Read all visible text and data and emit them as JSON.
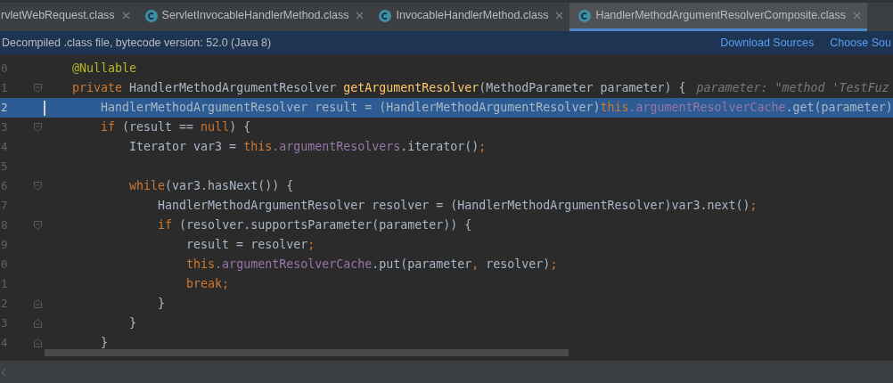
{
  "tabs": [
    {
      "label": "rvletWebRequest.class",
      "icon": false,
      "selected": false
    },
    {
      "label": "ServletInvocableHandlerMethod.class",
      "icon": true,
      "selected": false
    },
    {
      "label": "InvocableHandlerMethod.class",
      "icon": true,
      "selected": false
    },
    {
      "label": "HandlerMethodArgumentResolverComposite.class",
      "icon": true,
      "selected": true
    }
  ],
  "info_bar": {
    "message": "Decompiled .class file, bytecode version: 52.0 (Java 8)",
    "links": [
      "Download Sources",
      "Choose Sou"
    ]
  },
  "lines": [
    {
      "number": "0",
      "kind": "plain",
      "current": false,
      "tokens": [
        {
          "kind": "annotation",
          "t": "@Nullable"
        }
      ]
    },
    {
      "number": "1",
      "kind": "fold_start",
      "current": false,
      "tokens": [
        {
          "kind": "kw",
          "t": "private "
        },
        {
          "kind": "plain",
          "t": "HandlerMethodArgumentResolver "
        },
        {
          "kind": "method",
          "t": "getArgumentResolver"
        },
        {
          "kind": "plain",
          "t": "(MethodParameter parameter) {"
        }
      ],
      "hint": "parameter: \"method 'TestFuz"
    },
    {
      "number": "2",
      "kind": "plain",
      "current": true,
      "tokens": [
        {
          "kind": "plain",
          "t": "    HandlerMethodArgumentResolver result = (HandlerMethodArgumentResolver)"
        },
        {
          "kind": "kw",
          "t": "this"
        },
        {
          "kind": "field",
          "t": ".argumentResolverCache"
        },
        {
          "kind": "plain",
          "t": ".get(parameter)"
        }
      ]
    },
    {
      "number": "3",
      "kind": "fold_start",
      "current": false,
      "tokens": [
        {
          "kind": "kw",
          "t": "    if "
        },
        {
          "kind": "plain",
          "t": "(result == "
        },
        {
          "kind": "kw",
          "t": "null"
        },
        {
          "kind": "plain",
          "t": ") {"
        }
      ]
    },
    {
      "number": "4",
      "kind": "plain",
      "current": false,
      "tokens": [
        {
          "kind": "plain",
          "t": "        Iterator var3 = "
        },
        {
          "kind": "kw",
          "t": "this"
        },
        {
          "kind": "field",
          "t": ".argumentResolvers"
        },
        {
          "kind": "plain",
          "t": ".iterator()"
        },
        {
          "kind": "kw",
          "t": ";"
        }
      ]
    },
    {
      "number": "5",
      "kind": "plain",
      "current": false
    },
    {
      "number": "6",
      "kind": "fold_start",
      "current": false,
      "tokens": [
        {
          "kind": "kw",
          "t": "        while"
        },
        {
          "kind": "plain",
          "t": "(var3.hasNext()) {"
        }
      ]
    },
    {
      "number": "7",
      "kind": "plain",
      "current": false,
      "tokens": [
        {
          "kind": "plain",
          "t": "            HandlerMethodArgumentResolver resolver = (HandlerMethodArgumentResolver)var3.next()"
        },
        {
          "kind": "kw",
          "t": ";"
        }
      ]
    },
    {
      "number": "8",
      "kind": "fold_start",
      "current": false,
      "tokens": [
        {
          "kind": "kw",
          "t": "            if "
        },
        {
          "kind": "plain",
          "t": "(resolver.supportsParameter(parameter)) {"
        }
      ]
    },
    {
      "number": "9",
      "kind": "plain",
      "current": false,
      "tokens": [
        {
          "kind": "plain",
          "t": "                result = resolver"
        },
        {
          "kind": "kw",
          "t": ";"
        }
      ]
    },
    {
      "number": "0",
      "kind": "plain",
      "current": false,
      "tokens": [
        {
          "kind": "kw",
          "t": "                this"
        },
        {
          "kind": "field",
          "t": ".argumentResolverCache"
        },
        {
          "kind": "plain",
          "t": ".put(parameter"
        },
        {
          "kind": "kw",
          "t": ", "
        },
        {
          "kind": "plain",
          "t": "resolver)"
        },
        {
          "kind": "kw",
          "t": ";"
        }
      ]
    },
    {
      "number": "1",
      "kind": "plain",
      "current": false,
      "tokens": [
        {
          "kind": "kw",
          "t": "                break;"
        }
      ]
    },
    {
      "number": "2",
      "kind": "fold_end",
      "current": false,
      "tokens": [
        {
          "kind": "plain",
          "t": "            }"
        }
      ]
    },
    {
      "number": "3",
      "kind": "fold_end",
      "current": false,
      "tokens": [
        {
          "kind": "plain",
          "t": "        }"
        }
      ]
    },
    {
      "number": "4",
      "kind": "fold_end",
      "current": false,
      "tokens": [
        {
          "kind": "plain",
          "t": "    }"
        }
      ]
    }
  ]
}
